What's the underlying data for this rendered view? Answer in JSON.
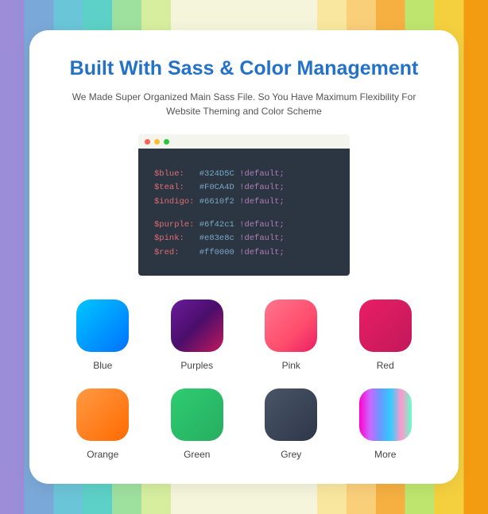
{
  "title": "Built With Sass & Color Management",
  "subtitle": "We Made Super Organized Main Sass File. So You Have Maximum Flexibility For Website Theming and Color Scheme",
  "code": {
    "lines_group1": [
      {
        "var": "$blue:   ",
        "val": "#324D5C ",
        "flag": "!default;"
      },
      {
        "var": "$teal:   ",
        "val": "#F0CA4D ",
        "flag": "!default;"
      },
      {
        "var": "$indigo: ",
        "val": "#6610f2 ",
        "flag": "!default;"
      }
    ],
    "lines_group2": [
      {
        "var": "$purple: ",
        "val": "#6f42c1 ",
        "flag": "!default;"
      },
      {
        "var": "$pink:   ",
        "val": "#e83e8c ",
        "flag": "!default;"
      },
      {
        "var": "$red:    ",
        "val": "#ff0000 ",
        "flag": "!default;"
      }
    ]
  },
  "swatches": [
    {
      "label": "Blue",
      "class": "sw-blue"
    },
    {
      "label": "Purples",
      "class": "sw-purples"
    },
    {
      "label": "Pink",
      "class": "sw-pink"
    },
    {
      "label": "Red",
      "class": "sw-red"
    },
    {
      "label": "Orange",
      "class": "sw-orange"
    },
    {
      "label": "Green",
      "class": "sw-green"
    },
    {
      "label": "Grey",
      "class": "sw-grey"
    },
    {
      "label": "More",
      "class": "sw-more"
    }
  ]
}
